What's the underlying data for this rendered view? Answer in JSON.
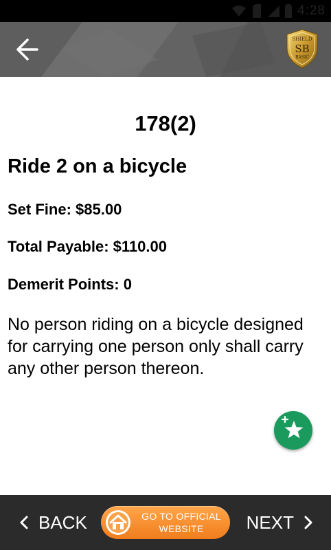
{
  "status_bar": {
    "time": "4:28"
  },
  "header": {
    "back_icon": "arrow-left-icon",
    "logo": {
      "line1": "SHIELD",
      "line2": "SB",
      "line3": "BASIC"
    }
  },
  "offence": {
    "code": "178(2)",
    "title": "Ride 2 on a bicycle",
    "set_fine": "Set Fine: $85.00",
    "total_payable": "Total Payable: $110.00",
    "demerit_points": "Demerit Points: 0",
    "description": "No person riding on a bicycle designed for carrying one person only shall carry any other person thereon."
  },
  "fab": {
    "icon": "add-favorite-star-icon",
    "color": "#1a9a5c"
  },
  "bottom_nav": {
    "back_label": "BACK",
    "next_label": "NEXT",
    "official_line1": "GO TO OFFICIAL",
    "official_line2": "WEBSITE",
    "accent": "#f5861f"
  }
}
